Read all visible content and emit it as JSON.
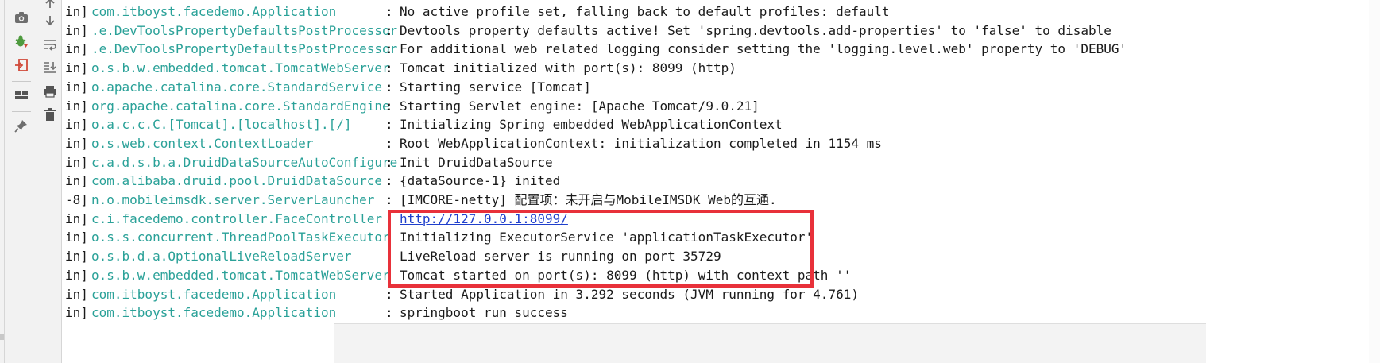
{
  "toolbar": {
    "column1": [
      {
        "icon": "camera-icon"
      },
      {
        "icon": "debug-bug-icon"
      },
      {
        "icon": "exit-to-icon"
      },
      {
        "icon": "layout-icon"
      },
      {
        "icon": "pin-icon"
      }
    ],
    "column2": [
      {
        "icon": "arrow-up-icon"
      },
      {
        "icon": "arrow-down-icon"
      },
      {
        "icon": "soft-wrap-icon"
      },
      {
        "icon": "scroll-to-end-icon"
      },
      {
        "icon": "print-icon"
      },
      {
        "icon": "trash-icon"
      }
    ]
  },
  "log": {
    "lines": [
      {
        "prefix": "in]",
        "logger": "com.itboyst.facedemo.Application",
        "sep": ":",
        "message": "No active profile set, falling back to default profiles: default"
      },
      {
        "prefix": "in]",
        "logger": ".e.DevToolsPropertyDefaultsPostProcessor",
        "sep": ":",
        "message": "Devtools property defaults active! Set 'spring.devtools.add-properties' to 'false' to disable"
      },
      {
        "prefix": "in]",
        "logger": ".e.DevToolsPropertyDefaultsPostProcessor",
        "sep": ":",
        "message": "For additional web related logging consider setting the 'logging.level.web' property to 'DEBUG'"
      },
      {
        "prefix": "in]",
        "logger": "o.s.b.w.embedded.tomcat.TomcatWebServer",
        "sep": ":",
        "message": "Tomcat initialized with port(s): 8099 (http)"
      },
      {
        "prefix": "in]",
        "logger": "o.apache.catalina.core.StandardService",
        "sep": ":",
        "message": "Starting service [Tomcat]"
      },
      {
        "prefix": "in]",
        "logger": "org.apache.catalina.core.StandardEngine",
        "sep": ":",
        "message": "Starting Servlet engine: [Apache Tomcat/9.0.21]"
      },
      {
        "prefix": "in]",
        "logger": "o.a.c.c.C.[Tomcat].[localhost].[/]",
        "sep": ":",
        "message": "Initializing Spring embedded WebApplicationContext"
      },
      {
        "prefix": "in]",
        "logger": "o.s.web.context.ContextLoader",
        "sep": ":",
        "message": "Root WebApplicationContext: initialization completed in 1154 ms"
      },
      {
        "prefix": "in]",
        "logger": "c.a.d.s.b.a.DruidDataSourceAutoConfigure",
        "sep": ":",
        "message": "Init DruidDataSource"
      },
      {
        "prefix": "in]",
        "logger": "com.alibaba.druid.pool.DruidDataSource",
        "sep": ":",
        "message": "{dataSource-1} inited"
      },
      {
        "prefix": "-8]",
        "logger": "n.o.mobileimsdk.server.ServerLauncher",
        "sep": ":",
        "message": "[IMCORE-netty] 配置项：未开启与MobileIMSDK Web的互通."
      },
      {
        "prefix": "in]",
        "logger": "c.i.facedemo.controller.FaceController",
        "sep": ":",
        "message": "http://127.0.0.1:8099/",
        "link": true
      },
      {
        "prefix": "in]",
        "logger": "o.s.s.concurrent.ThreadPoolTaskExecutor",
        "sep": ":",
        "message": "Initializing ExecutorService 'applicationTaskExecutor'"
      },
      {
        "prefix": "in]",
        "logger": "o.s.b.d.a.OptionalLiveReloadServer",
        "sep": ":",
        "message": "LiveReload server is running on port 35729"
      },
      {
        "prefix": "in]",
        "logger": "o.s.b.w.embedded.tomcat.TomcatWebServer",
        "sep": ":",
        "message": "Tomcat started on port(s): 8099 (http) with context path ''"
      },
      {
        "prefix": "in]",
        "logger": "com.itboyst.facedemo.Application",
        "sep": ":",
        "message": "Started Application in 3.292 seconds (JVM running for 4.761)"
      },
      {
        "prefix": "in]",
        "logger": "com.itboyst.facedemo.Application",
        "sep": ":",
        "message": "springboot run success"
      }
    ]
  },
  "colors": {
    "logger": "#2aa198",
    "link": "#1f3fcc",
    "highlight": "#e8313a"
  }
}
